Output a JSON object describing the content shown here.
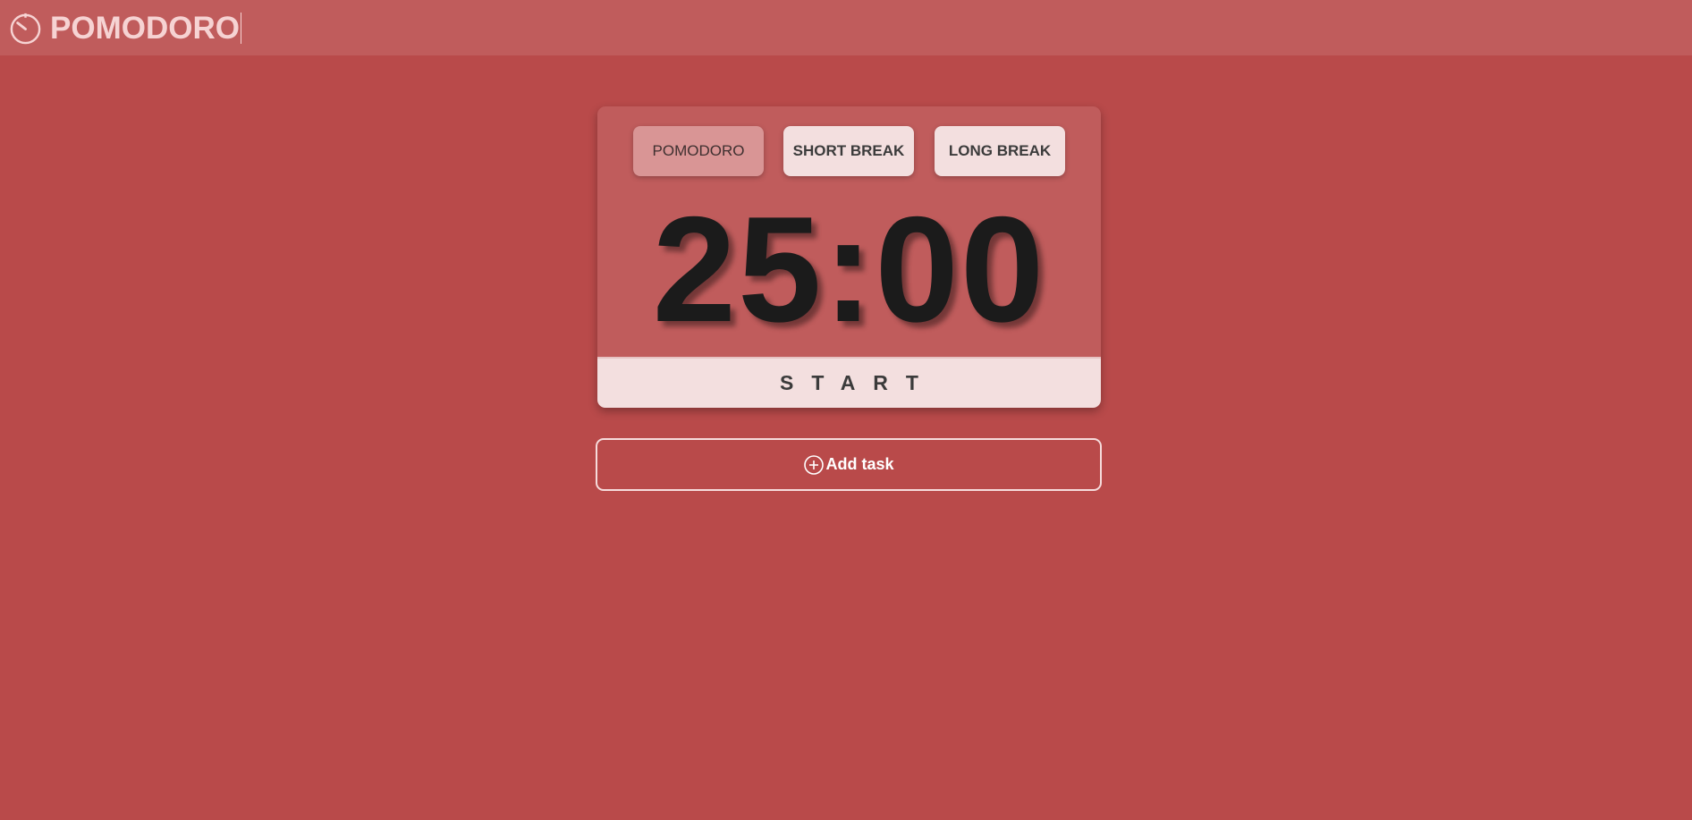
{
  "header": {
    "title": "POMODORO",
    "logo_icon": "timer-icon"
  },
  "modes": [
    {
      "label": "POMODORO",
      "active": true
    },
    {
      "label": "SHORT BREAK",
      "active": false
    },
    {
      "label": "LONG BREAK",
      "active": false
    }
  ],
  "timer": {
    "display": "25:00"
  },
  "start_button": {
    "label": "START"
  },
  "add_task": {
    "label": "Add task",
    "icon": "plus-circle-icon"
  },
  "colors": {
    "background": "#b94a4a",
    "header": "#c05c5c",
    "card": "#c05c5c",
    "button_bg": "#f3dfdf",
    "active_button_bg": "#d99595",
    "timer_text": "#1b1b1b"
  }
}
